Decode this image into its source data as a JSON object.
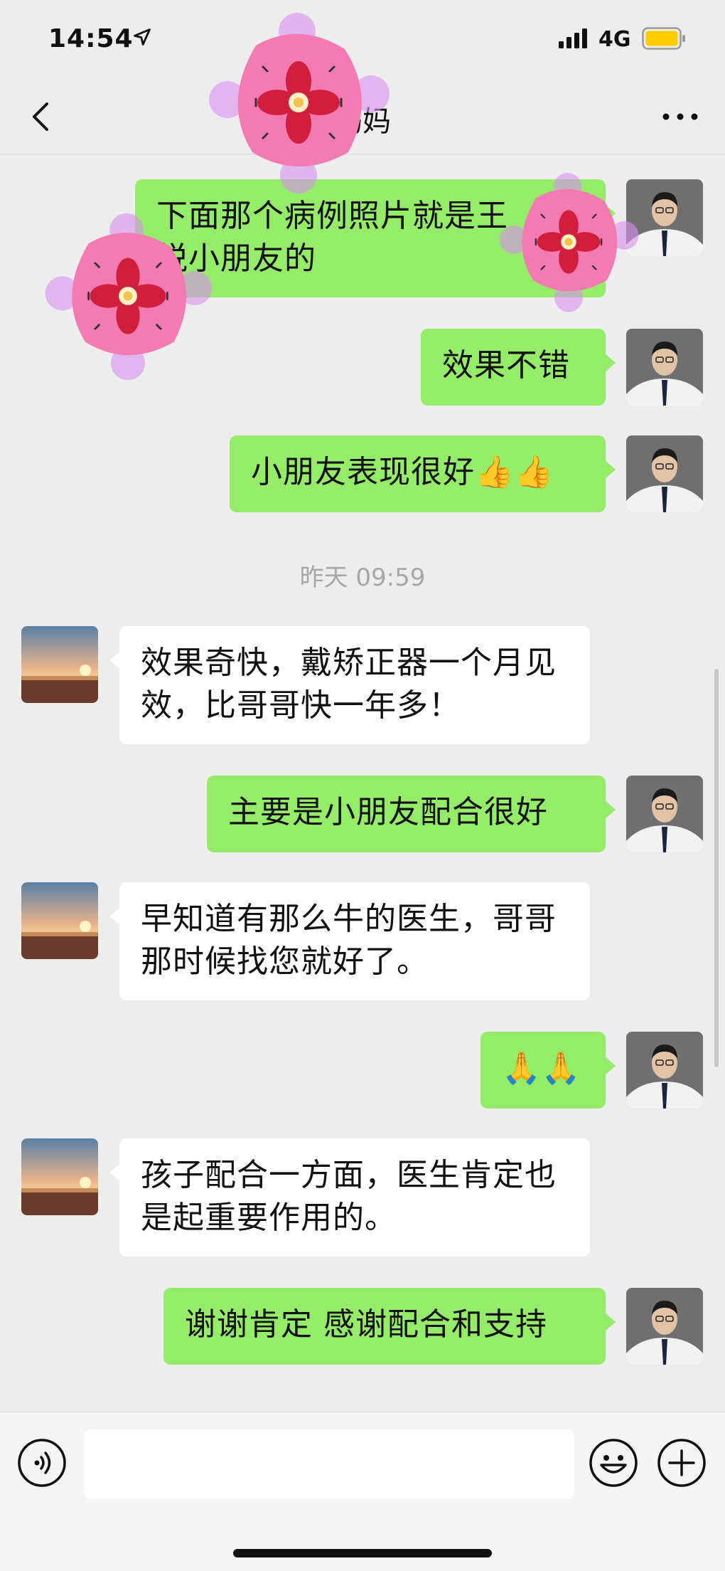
{
  "status_bar": {
    "time": "14:54",
    "network": "4G"
  },
  "nav": {
    "title": "妈妈"
  },
  "messages": [
    {
      "text_line1": "下面那个病例照片就是王",
      "text_line2": "悦小朋友的"
    },
    {
      "text": "效果不错"
    },
    {
      "text": "小朋友表现很好👍👍"
    },
    {
      "text": "效果奇快，戴矫正器一个月见效，比哥哥快一年多！"
    },
    {
      "text": "主要是小朋友配合很好"
    },
    {
      "text": "早知道有那么牛的医生，哥哥那时候找您就好了。"
    },
    {
      "text": "🙏🙏"
    },
    {
      "text": "孩子配合一方面，医生肯定也是起重要作用的。"
    },
    {
      "text": "谢谢肯定 感谢配合和支持"
    }
  ],
  "time_divider": "昨天 09:59",
  "colors": {
    "self_bubble": "#95ec69",
    "peer_bubble": "#ffffff",
    "background": "#ededed"
  }
}
